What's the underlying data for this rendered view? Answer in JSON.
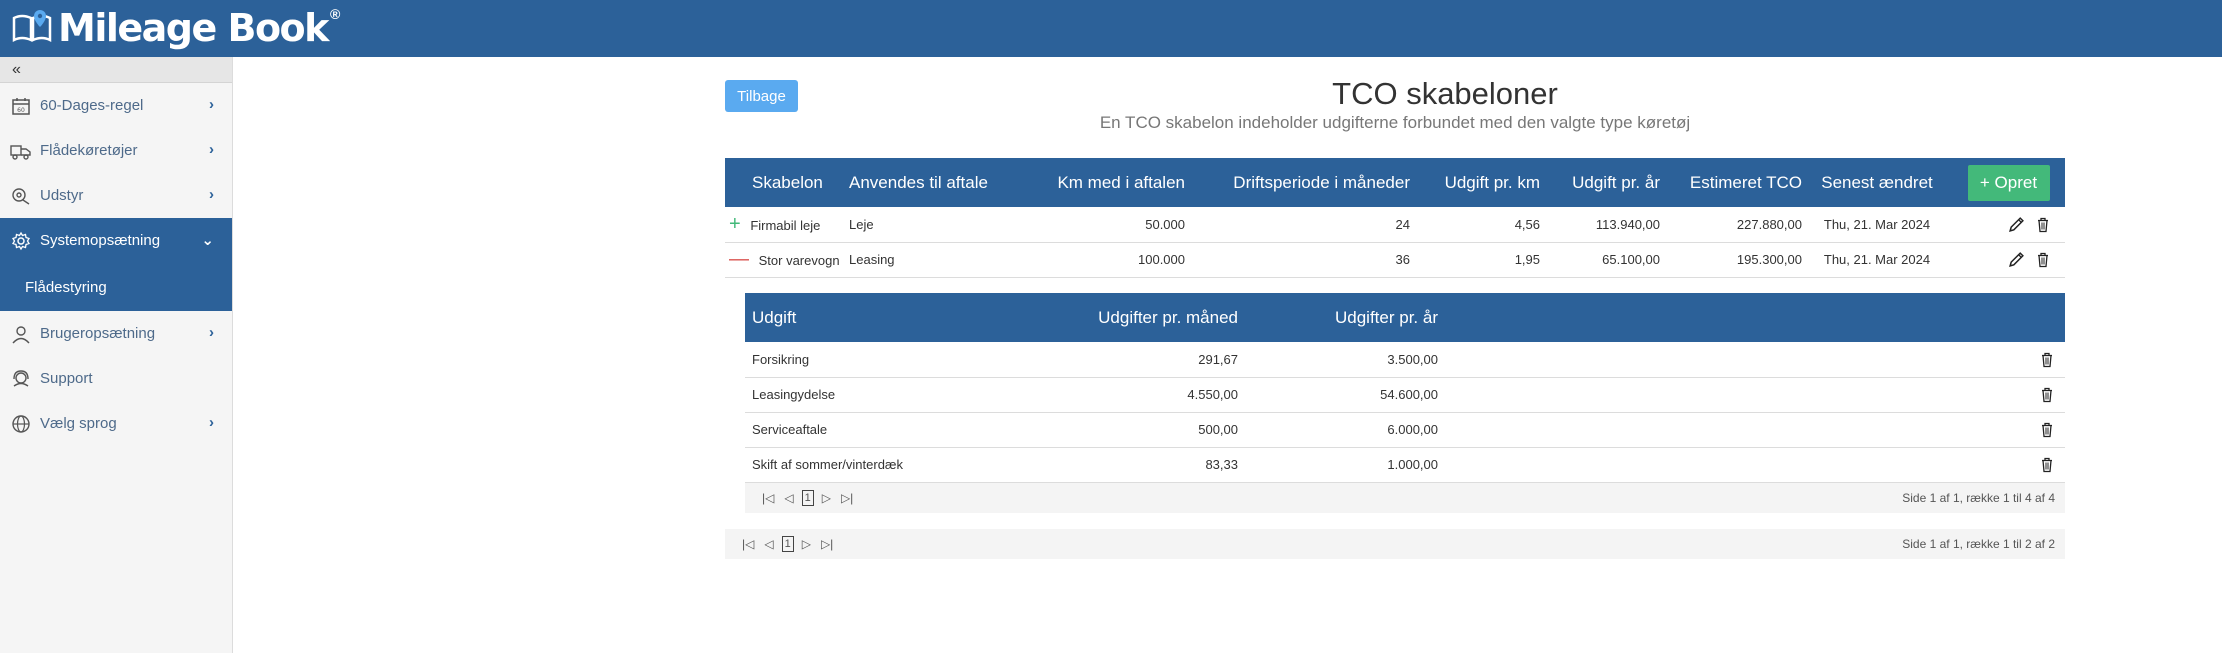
{
  "app": {
    "logo_text": "Mileage Book",
    "logo_reg": "®"
  },
  "sidebar": {
    "collapse_icon": "«",
    "items": [
      {
        "label": "60-Dages-regel",
        "icon": "calendar-60-icon"
      },
      {
        "label": "Flådekøretøjer",
        "icon": "vehicles-icon"
      },
      {
        "label": "Udstyr",
        "icon": "equipment-icon"
      },
      {
        "label": "Systemopsætning",
        "icon": "gear-icon",
        "active": true,
        "sub": [
          "Flådestyring"
        ]
      },
      {
        "label": "Brugeropsætning",
        "icon": "user-icon"
      },
      {
        "label": "Support",
        "icon": "support-icon"
      },
      {
        "label": "Vælg sprog",
        "icon": "globe-icon"
      }
    ]
  },
  "main": {
    "back_label": "Tilbage",
    "title": "TCO skabeloner",
    "subtitle": "En TCO skabelon indeholder udgifterne forbundet med den valgte type køretøj",
    "table": {
      "headers": [
        "Skabelon",
        "Anvendes til aftale",
        "Km med i aftalen",
        "Driftsperiode i måneder",
        "Udgift pr. km",
        "Udgift pr. år",
        "Estimeret TCO",
        "Senest ændret"
      ],
      "create_label": "+ Opret",
      "rows": [
        {
          "expander": "+",
          "name": "Firmabil leje",
          "agreement": "Leje",
          "km": "50.000",
          "period": "24",
          "per_km": "4,56",
          "per_year": "113.940,00",
          "tco": "227.880,00",
          "changed": "Thu, 21. Mar 2024"
        },
        {
          "expander": "—",
          "name": "Stor varevogn",
          "agreement": "Leasing",
          "km": "100.000",
          "period": "36",
          "per_km": "1,95",
          "per_year": "65.100,00",
          "tco": "195.300,00",
          "changed": "Thu, 21. Mar 2024"
        }
      ]
    },
    "detail": {
      "headers": [
        "Udgift",
        "Udgifter pr. måned",
        "Udgifter pr. år"
      ],
      "rows": [
        {
          "name": "Forsikring",
          "monthly": "291,67",
          "yearly": "3.500,00"
        },
        {
          "name": "Leasingydelse",
          "monthly": "4.550,00",
          "yearly": "54.600,00"
        },
        {
          "name": "Serviceaftale",
          "monthly": "500,00",
          "yearly": "6.000,00"
        },
        {
          "name": "Skift af sommer/vinterdæk",
          "monthly": "83,33",
          "yearly": "1.000,00"
        }
      ],
      "pager": {
        "page": "1",
        "info": "Side 1 af 1, række 1 til 4 af 4"
      }
    },
    "pager": {
      "page": "1",
      "info": "Side 1 af 1, række 1 til 2 af 2"
    }
  },
  "colors": {
    "primary": "#2c6199",
    "back_button": "#5aaaf0",
    "create_button": "#43b97a"
  }
}
